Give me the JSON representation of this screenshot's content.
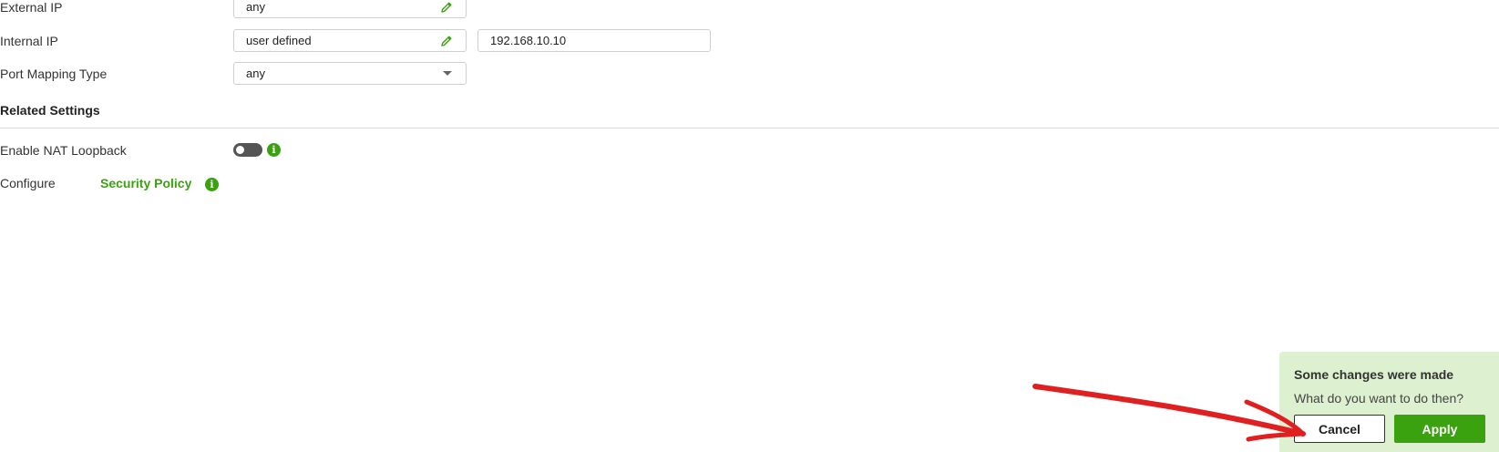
{
  "form": {
    "external_ip": {
      "label": "External IP",
      "value": "any"
    },
    "internal_ip": {
      "label": "Internal IP",
      "value": "user defined",
      "address": "192.168.10.10"
    },
    "port_mapping": {
      "label": "Port Mapping Type",
      "value": "any"
    }
  },
  "related_settings": {
    "title": "Related Settings",
    "nat_loopback": {
      "label": "Enable NAT Loopback",
      "enabled": false
    },
    "configure": {
      "label": "Configure",
      "link": "Security Policy"
    }
  },
  "popup": {
    "title": "Some changes were made",
    "message": "What do you want to do then?",
    "cancel_label": "Cancel",
    "apply_label": "Apply"
  },
  "colors": {
    "accent": "#3aa10f",
    "popup_bg": "#ddf0cf",
    "annotation_arrow": "#e02020"
  },
  "icons": {
    "edit": "pencil-icon",
    "info": "info-icon",
    "dropdown": "caret-down-icon"
  }
}
